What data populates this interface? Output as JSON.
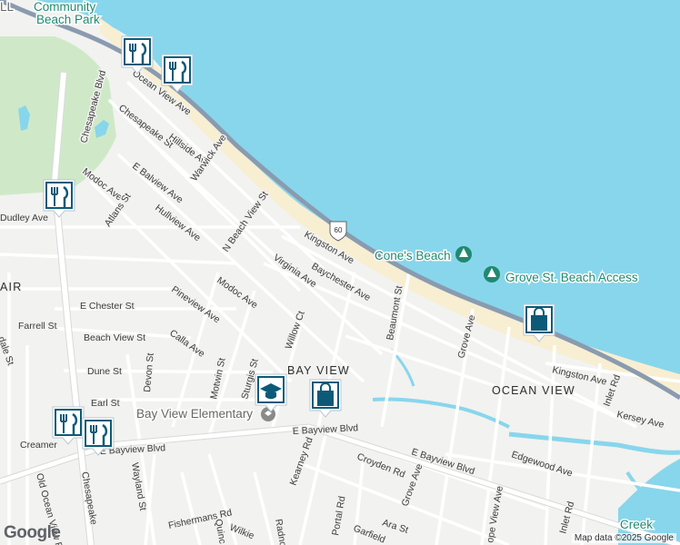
{
  "map": {
    "colors": {
      "water": "#88d6ec",
      "land": "#f2f2f0",
      "park": "#cfe9c8",
      "beach": "#f8eed2",
      "highway": "#8a9bb0",
      "road": "#ffffff",
      "marker_fill": "#0c5a78"
    },
    "areas": [
      "BAY VIEW",
      "OCEAN VIEW",
      "AIR"
    ],
    "pois": {
      "community_beach_park": [
        "Community",
        "Beach Park"
      ],
      "cones_beach": "Cone's Beach",
      "grove_st_beach": "Grove St. Beach Access",
      "bay_view_elementary": "Bay View Elementary",
      "creek": "Creek",
      "corner": "LL"
    },
    "route_shield": "60",
    "streets": {
      "ocean_view_ave": "Ocean View Ave",
      "chesapeake_blvd_top": "Chesapeake Blvd",
      "chesapeake_blvd_bottom": "Chesapeake",
      "chesapeake_st": "Chesapeake St",
      "hillside_ave": "Hillside Ave",
      "warwick_ave": "Warwick Ave",
      "e_balview_ave": "E Balview Ave",
      "hullview_ave": "Hullview Ave",
      "n_beach_view_st": "N Beach View St",
      "modoc_ave_top": "Modoc Ave",
      "atlans_st": "Atlans St",
      "dudley_ave": "Dudley Ave",
      "kingston_ave_top": "Kingston Ave",
      "baychester_ave": "Baychester Ave",
      "virginia_ave": "Virginia Ave",
      "modoc_ave": "Modoc Ave",
      "e_chester_st": "E Chester St",
      "farrell_st": "Farrell St",
      "pineview_ave": "Pineview Ave",
      "beach_view_st": "Beach View St",
      "calla_ave": "Calla Ave",
      "willow_ct": "Willow Ct",
      "beaumont_st": "Beaumont St",
      "grove_ave_top": "Grove Ave",
      "kingston_ave_right": "Kingston Ave",
      "inlet_rd_top": "Inlet Rd",
      "kersey_ave": "Kersey Ave",
      "dune_st": "Dune St",
      "devon_st": "Devon St",
      "motwin_st": "Motwin St",
      "sturgis_st": "Sturgis St",
      "earl_st": "Earl St",
      "e_bayview_blvd_left": "E Bayview Blvd",
      "e_bayview_blvd_center": "E Bayview Blvd",
      "e_bayview_blvd_right": "E Bayview Blvd",
      "creamer": "Creamer",
      "wayland_st": "Wayland St",
      "old_ocean_view_rd": "Old Ocean View Rd",
      "kearney_rd": "Kearney Rd",
      "croyden_rd": "Croyden Rd",
      "grove_ave_bottom": "Grove Ave",
      "edgewood_ave": "Edgewood Ave",
      "portal_rd": "Portal Rd",
      "ara_st": "Ara St",
      "garfield": "Garfield",
      "fishermans_rd": "Fishermans Rd",
      "wilkie": "Wilkie",
      "quinc": "Quinc",
      "radno": "Radno",
      "inlet_rd_bottom": "Inlet Rd",
      "ope_view_ave": "ope View Ave",
      "dale_st": "dale St"
    },
    "markers": [
      {
        "type": "restaurant",
        "icon": "fork-knife-icon"
      },
      {
        "type": "restaurant",
        "icon": "fork-knife-icon"
      },
      {
        "type": "restaurant",
        "icon": "fork-knife-icon"
      },
      {
        "type": "school",
        "icon": "graduation-cap-icon"
      },
      {
        "type": "shopping",
        "icon": "shopping-bag-icon"
      },
      {
        "type": "shopping",
        "icon": "shopping-bag-icon"
      },
      {
        "type": "restaurant",
        "icon": "fork-knife-icon"
      },
      {
        "type": "restaurant",
        "icon": "fork-knife-icon"
      }
    ]
  },
  "footer": {
    "attribution": "Map data ©2025 Google",
    "logo": "Google"
  }
}
